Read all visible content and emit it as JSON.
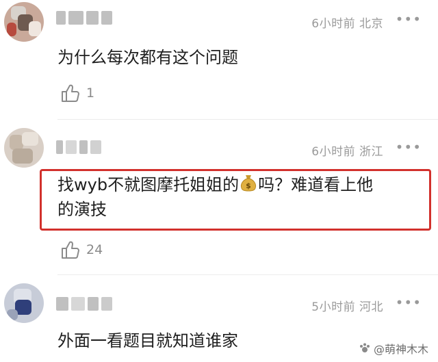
{
  "comments": [
    {
      "time": "6小时前",
      "location": "北京",
      "text": "为什么每次都有这个问题",
      "likes": "1",
      "more_icon": "more-dots-icon"
    },
    {
      "time": "6小时前",
      "location": "浙江",
      "text_line1_a": "找wyb不就图摩托姐姐的",
      "text_line1_b": "吗？难道看上他",
      "text_line2": "的演技",
      "likes": "24",
      "more_icon": "more-dots-icon"
    },
    {
      "time": "5小时前",
      "location": "河北",
      "text": "外面一看题目就知道谁家",
      "more_icon": "more-dots-icon"
    }
  ],
  "watermark": "@萌神木木",
  "colors": {
    "highlight_border": "#d2302c",
    "meta_text": "#9a9a9a",
    "body_text": "#1e1e1e"
  }
}
